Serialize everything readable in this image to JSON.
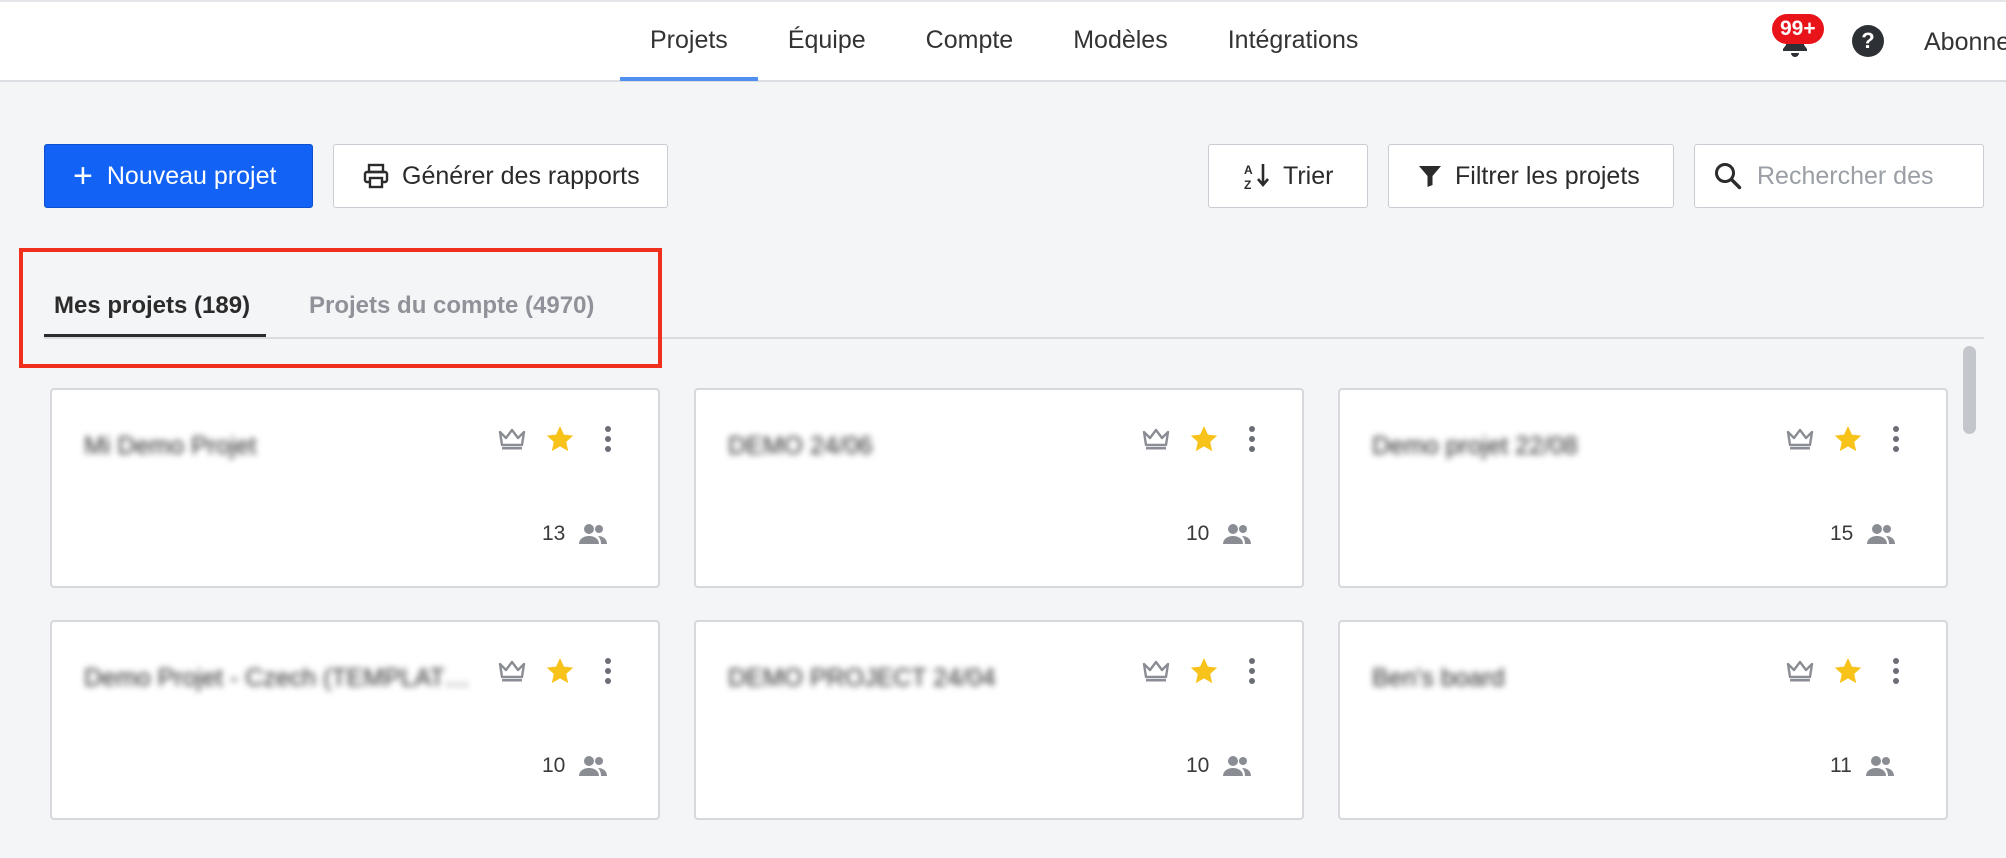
{
  "nav": {
    "tabs": [
      {
        "label": "Projets",
        "active": true
      },
      {
        "label": "Équipe"
      },
      {
        "label": "Compte"
      },
      {
        "label": "Modèles"
      },
      {
        "label": "Intégrations"
      }
    ],
    "notifications_badge": "99+",
    "help_glyph": "?",
    "account_link": "Abonne"
  },
  "toolbar": {
    "new_project_label": "Nouveau projet",
    "reports_label": "Générer des rapports",
    "sort_label": "Trier",
    "filter_label": "Filtrer les projets",
    "search_placeholder": "Rechercher des"
  },
  "project_tabs": {
    "mine_label": "Mes projets (189)",
    "account_label": "Projets du compte (4970)"
  },
  "projects": [
    {
      "title": "Mi Demo Projet",
      "members": "13"
    },
    {
      "title": "DEMO 24/06",
      "members": "10"
    },
    {
      "title": "Demo projet 22/08",
      "members": "15"
    },
    {
      "title": "Demo Projet - Czech (TEMPLAT…",
      "members": "10"
    },
    {
      "title": "DEMO PROJECT 24/04",
      "members": "10"
    },
    {
      "title": "Ben's board",
      "members": "11"
    }
  ],
  "colors": {
    "primary": "#1262f5",
    "highlight": "#f0301c",
    "star": "#f7c21a",
    "badge": "#e8141a"
  }
}
